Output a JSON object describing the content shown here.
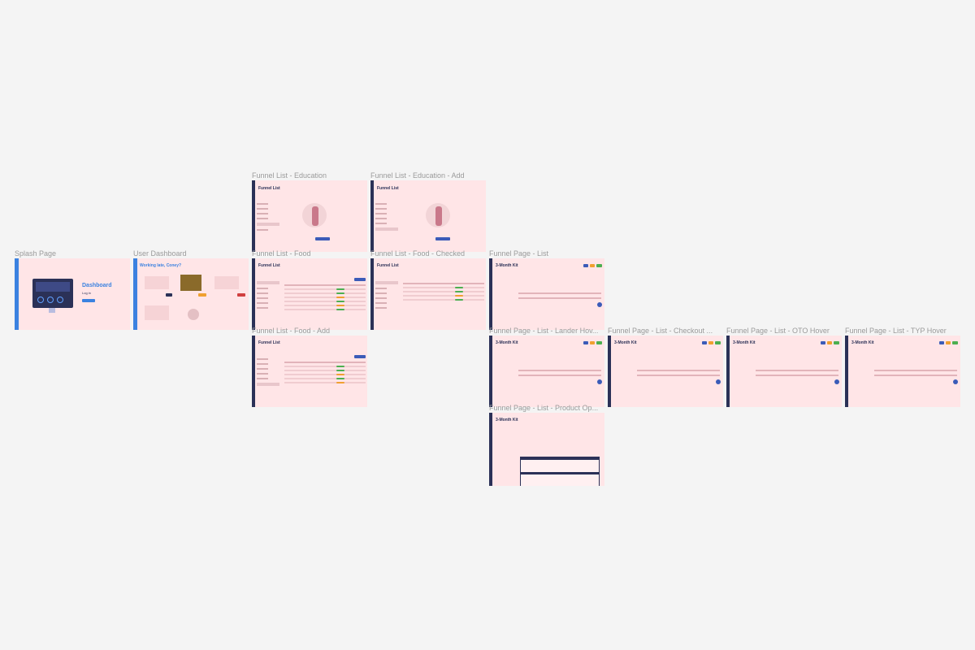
{
  "frames": {
    "splash": {
      "label": "Splash Page",
      "heading": "Dashboard",
      "login": "Log in"
    },
    "user_dashboard": {
      "label": "User Dashboard",
      "heading": "Working late, Coney?"
    },
    "edu": {
      "label": "Funnel List - Education",
      "heading": "Funnel List"
    },
    "edu_add": {
      "label": "Funnel List - Education - Add",
      "heading": "Funnel List"
    },
    "food": {
      "label": "Funnel List - Food",
      "heading": "Funnel List"
    },
    "food_checked": {
      "label": "Funnel List - Food - Checked",
      "heading": "Funnel List"
    },
    "food_add": {
      "label": "Funnel List - Food - Add",
      "heading": "Funnel List"
    },
    "page_list": {
      "label": "Funnel Page - List",
      "heading": "3-Month Kit"
    },
    "lander_hover": {
      "label": "Funnel Page - List - Lander Hov...",
      "heading": "3-Month Kit"
    },
    "checkout": {
      "label": "Funnel Page - List - Checkout ...",
      "heading": "3-Month Kit"
    },
    "oto_hover": {
      "label": "Funnel Page - List - OTO Hover",
      "heading": "3-Month Kit"
    },
    "typ_hover": {
      "label": "Funnel Page - List - TYP Hover",
      "heading": "3-Month Kit"
    },
    "product_op": {
      "label": "Funnel Page - List - Product Op...",
      "heading": "3-Month Kit"
    }
  },
  "colors": {
    "canvas": "#f4f4f4",
    "frame_bg": "#ffe5e7",
    "sidebar": "#2b3157",
    "accent_blue": "#3b82e0",
    "green": "#4caf50",
    "orange": "#f0a030"
  }
}
